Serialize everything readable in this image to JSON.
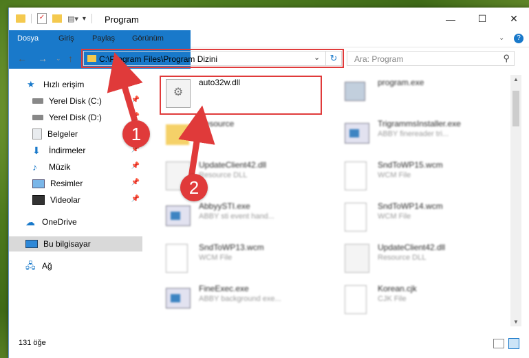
{
  "window": {
    "title": "Program",
    "controls": {
      "minimize": "—",
      "maximize": "☐",
      "close": "✕"
    }
  },
  "ribbon": {
    "tabs": [
      "Dosya",
      "Giriş",
      "Paylaş",
      "Görünüm"
    ]
  },
  "nav": {
    "address": "C:\\Program Files\\Program Dizini",
    "search_placeholder": "Ara: Program"
  },
  "sidebar": {
    "items": [
      {
        "label": "Hızlı erişim",
        "icon": "star-icon"
      },
      {
        "label": "Yerel Disk (C:)",
        "icon": "drive-icon"
      },
      {
        "label": "Yerel Disk (D:)",
        "icon": "drive-icon"
      },
      {
        "label": "Belgeler",
        "icon": "document-icon"
      },
      {
        "label": "İndirmeler",
        "icon": "download-icon"
      },
      {
        "label": "Müzik",
        "icon": "music-icon"
      },
      {
        "label": "Resimler",
        "icon": "picture-icon"
      },
      {
        "label": "Videolar",
        "icon": "video-icon"
      },
      {
        "label": "OneDrive",
        "icon": "cloud-icon"
      },
      {
        "label": "Bu bilgisayar",
        "icon": "computer-icon"
      },
      {
        "label": "Ağ",
        "icon": "network-icon"
      }
    ]
  },
  "files": [
    {
      "name": "auto32w.dll",
      "desc": ""
    },
    {
      "name": "program.exe",
      "desc": ""
    },
    {
      "name": "Resource",
      "desc": ""
    },
    {
      "name": "TrigrammsInstaller.exe",
      "desc": "ABBY finereader tri..."
    },
    {
      "name": "UpdateClient42.dll",
      "desc": "Resource DLL"
    },
    {
      "name": "SndToWP15.wcm",
      "desc": "WCM File"
    },
    {
      "name": "AbbyySTI.exe",
      "desc": "ABBY sti event hand..."
    },
    {
      "name": "SndToWP14.wcm",
      "desc": "WCM File"
    },
    {
      "name": "SndToWP13.wcm",
      "desc": "WCM File"
    },
    {
      "name": "UpdateClient42.dll",
      "desc": "Resource DLL"
    },
    {
      "name": "FineExec.exe",
      "desc": "ABBY background exe..."
    },
    {
      "name": "Korean.cjk",
      "desc": "CJK File"
    }
  ],
  "status": {
    "count": "131 öğe"
  },
  "annotations": {
    "step1": "1",
    "step2": "2"
  },
  "colors": {
    "accent": "#1979ca",
    "annotation": "#e03a3a"
  }
}
